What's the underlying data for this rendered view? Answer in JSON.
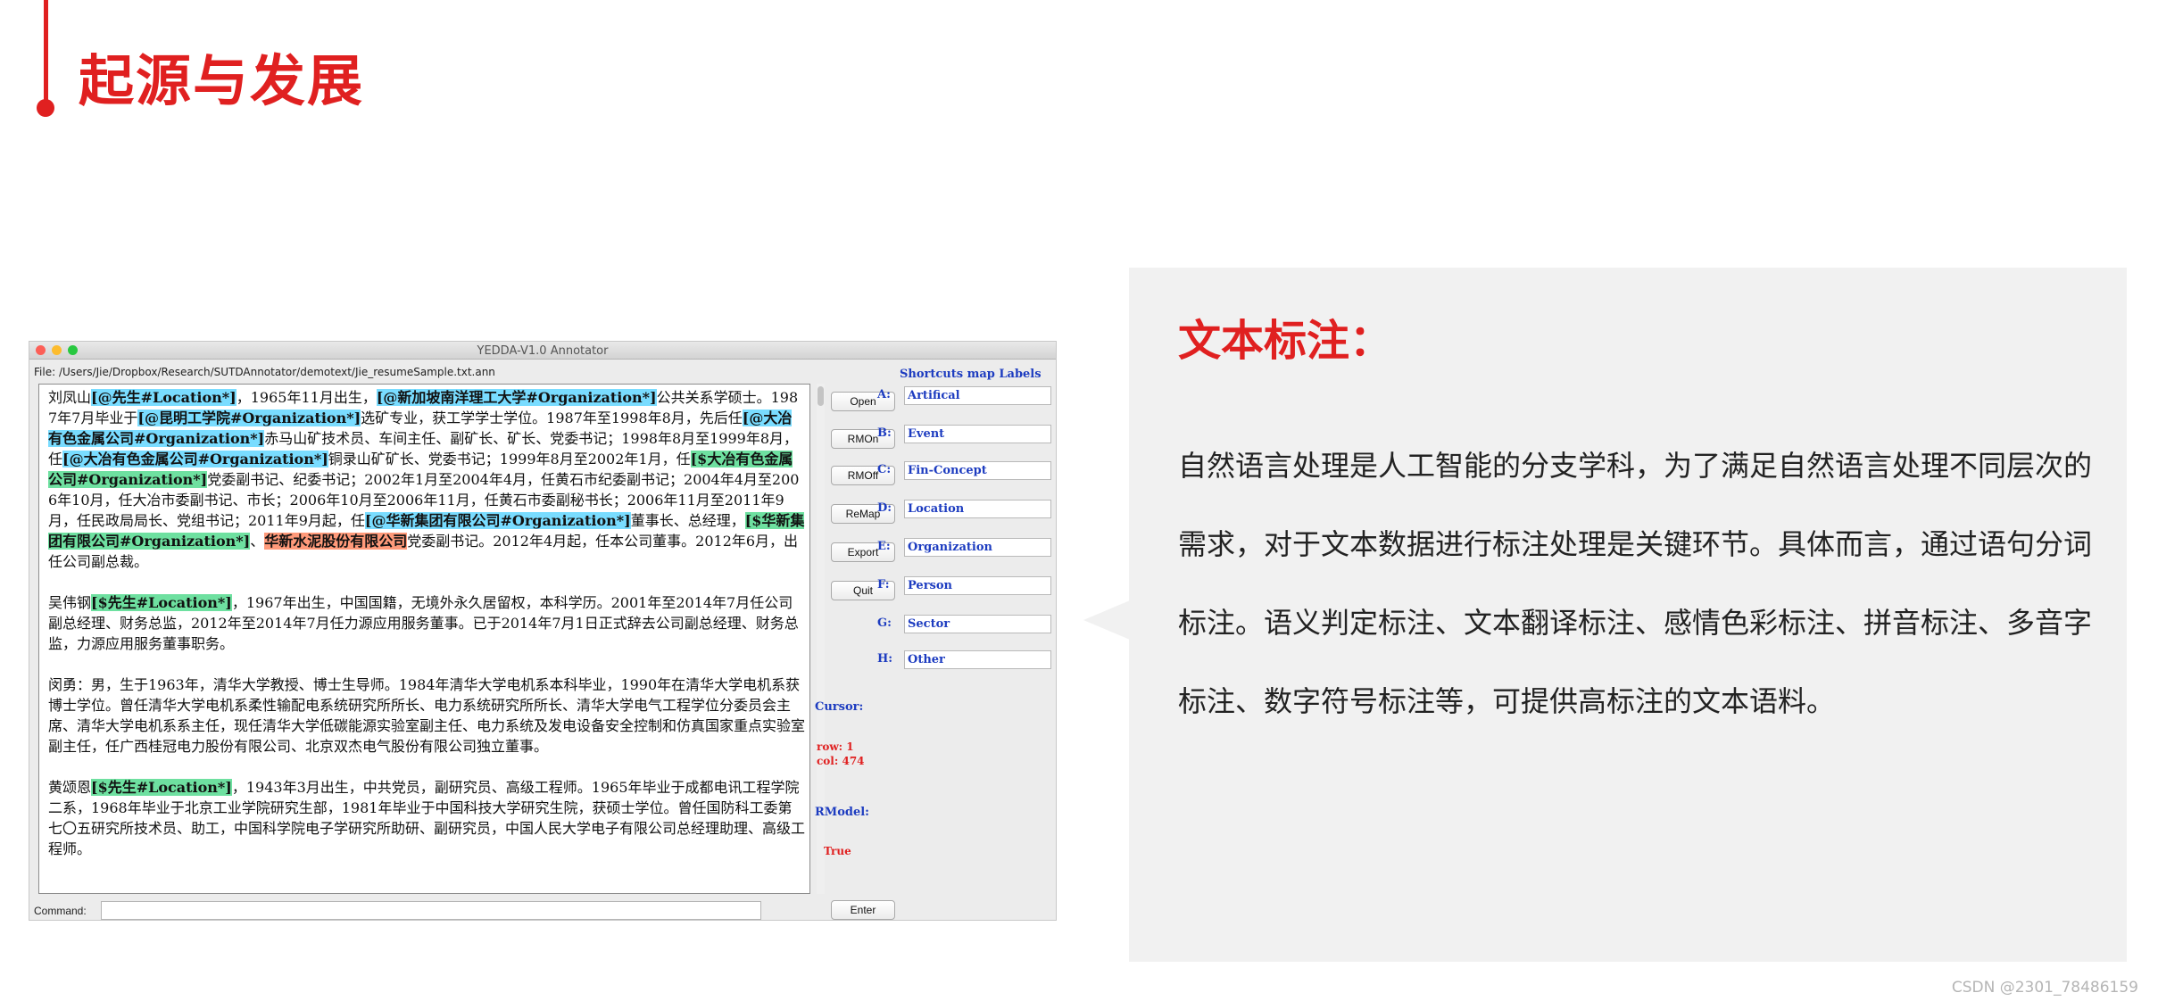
{
  "slide": {
    "title": "起源与发展",
    "watermark": "CSDN @2301_78486159"
  },
  "window": {
    "title": "YEDDA-V1.0 Annotator",
    "file_path": "File: /Users/Jie/Dropbox/Research/SUTDAnnotator/demotext/Jie_resumeSample.txt.ann"
  },
  "text_pane": {
    "paragraphs": [
      [
        {
          "t": "刘凤山"
        },
        {
          "t": "[@先生#Location*]",
          "c": "blue"
        },
        {
          "t": "，1965年11月出生，"
        },
        {
          "t": "[@新加坡南洋理工大学#Organization*]",
          "c": "blue"
        },
        {
          "t": "公共关系学硕士。1987年7月毕业于"
        },
        {
          "t": "[@昆明工学院#Organization*]",
          "c": "blue"
        },
        {
          "t": "选矿专业，获工学学士学位。1987年至1998年8月，先后任"
        },
        {
          "t": "[@大冶有色金属公司#Organization*]",
          "c": "blue"
        },
        {
          "t": "赤马山矿技术员、车间主任、副矿长、矿长、党委书记；1998年8月至1999年8月，任"
        },
        {
          "t": "[@大冶有色金属公司#Organization*]",
          "c": "blue"
        },
        {
          "t": "铜录山矿矿长、党委书记；1999年8月至2002年1月，任"
        },
        {
          "t": "[$大冶有色金属公司#Organization*]",
          "c": "green"
        },
        {
          "t": "党委副书记、纪委书记；2002年1月至2004年4月，任黄石市纪委副书记；2004年4月至2006年10月，任大冶市委副书记、市长；2006年10月至2006年11月，任黄石市委副秘书长；2006年11月至2011年9月，任民政局局长、党组书记；2011年9月起，任"
        },
        {
          "t": "[@华新集团有限公司#Organization*]",
          "c": "blue"
        },
        {
          "t": "董事长、总经理，"
        },
        {
          "t": "[$华新集团有限公司#Organization*]",
          "c": "green"
        },
        {
          "t": "、"
        },
        {
          "t": "华新水泥股份有限公司",
          "c": "orange"
        },
        {
          "t": "党委副书记。2012年4月起，任本公司董事。2012年6月，出任公司副总裁。"
        }
      ],
      [
        {
          "t": "吴伟钢"
        },
        {
          "t": "[$先生#Location*]",
          "c": "green"
        },
        {
          "t": "，1967年出生，中国国籍，无境外永久居留权，本科学历。2001年至2014年7月任公司副总经理、财务总监，2012年至2014年7月任力源应用服务董事。已于2014年7月1日正式辞去公司副总经理、财务总监，力源应用服务董事职务。"
        }
      ],
      [
        {
          "t": "闵勇：男，生于1963年，清华大学教授、博士生导师。1984年清华大学电机系本科毕业，1990年在清华大学电机系获博士学位。曾任清华大学电机系柔性输配电系统研究所所长、电力系统研究所所长、清华大学电气工程学位分委员会主席、清华大学电机系系主任，现任清华大学低碳能源实验室副主任、电力系统及发电设备安全控制和仿真国家重点实验室副主任，任广西桂冠电力股份有限公司、北京双杰电气股份有限公司独立董事。"
        }
      ],
      [
        {
          "t": "黄颂恩"
        },
        {
          "t": "[$先生#Location*]",
          "c": "green"
        },
        {
          "t": "，1943年3月出生，中共党员，副研究员、高级工程师。1965年毕业于成都电讯工程学院二系，1968年毕业于北京工业学院研究生部，1981年毕业于中国科技大学研究生院，获硕士学位。曾任国防科工委第七〇五研究所技术员、助工，中国科学院电子学研究所助研、副研究员，中国人民大学电子有限公司总经理助理、高级工程师。"
        }
      ]
    ]
  },
  "buttons": [
    "Open",
    "RMOn",
    "RMOff",
    "ReMap",
    "Export",
    "Quit"
  ],
  "enter_button": "Enter",
  "shortcuts": {
    "title": "Shortcuts map Labels",
    "items": [
      {
        "key": "A:",
        "label": "Artifical"
      },
      {
        "key": "B:",
        "label": "Event"
      },
      {
        "key": "C:",
        "label": "Fin-Concept"
      },
      {
        "key": "D:",
        "label": "Location"
      },
      {
        "key": "E:",
        "label": "Organization"
      },
      {
        "key": "F:",
        "label": "Person"
      },
      {
        "key": "G:",
        "label": "Sector"
      },
      {
        "key": "H:",
        "label": "Other"
      }
    ]
  },
  "status": {
    "cursor_label": "Cursor:",
    "cursor_row": "row: 1",
    "cursor_col": "col: 474",
    "rmodel_label": "RModel:",
    "rmodel_value": "True"
  },
  "command": {
    "label": "Command:",
    "value": ""
  },
  "panel": {
    "title": "文本标注：",
    "body": "自然语言处理是人工智能的分支学科，为了满足自然语言处理不同层次的需求，对于文本数据进行标注处理是关键环节。具体而言，通过语句分词标注。语义判定标注、文本翻译标注、感情色彩标注、拼音标注、多音字标注、数字符号标注等，可提供高标注的文本语料。"
  },
  "colors": {
    "accent_red": "#e02020",
    "label_blue": "#1d3cc0",
    "tag_blue": "#79dcff",
    "tag_green": "#6ee0a0",
    "tag_orange": "#ff9a7a"
  }
}
